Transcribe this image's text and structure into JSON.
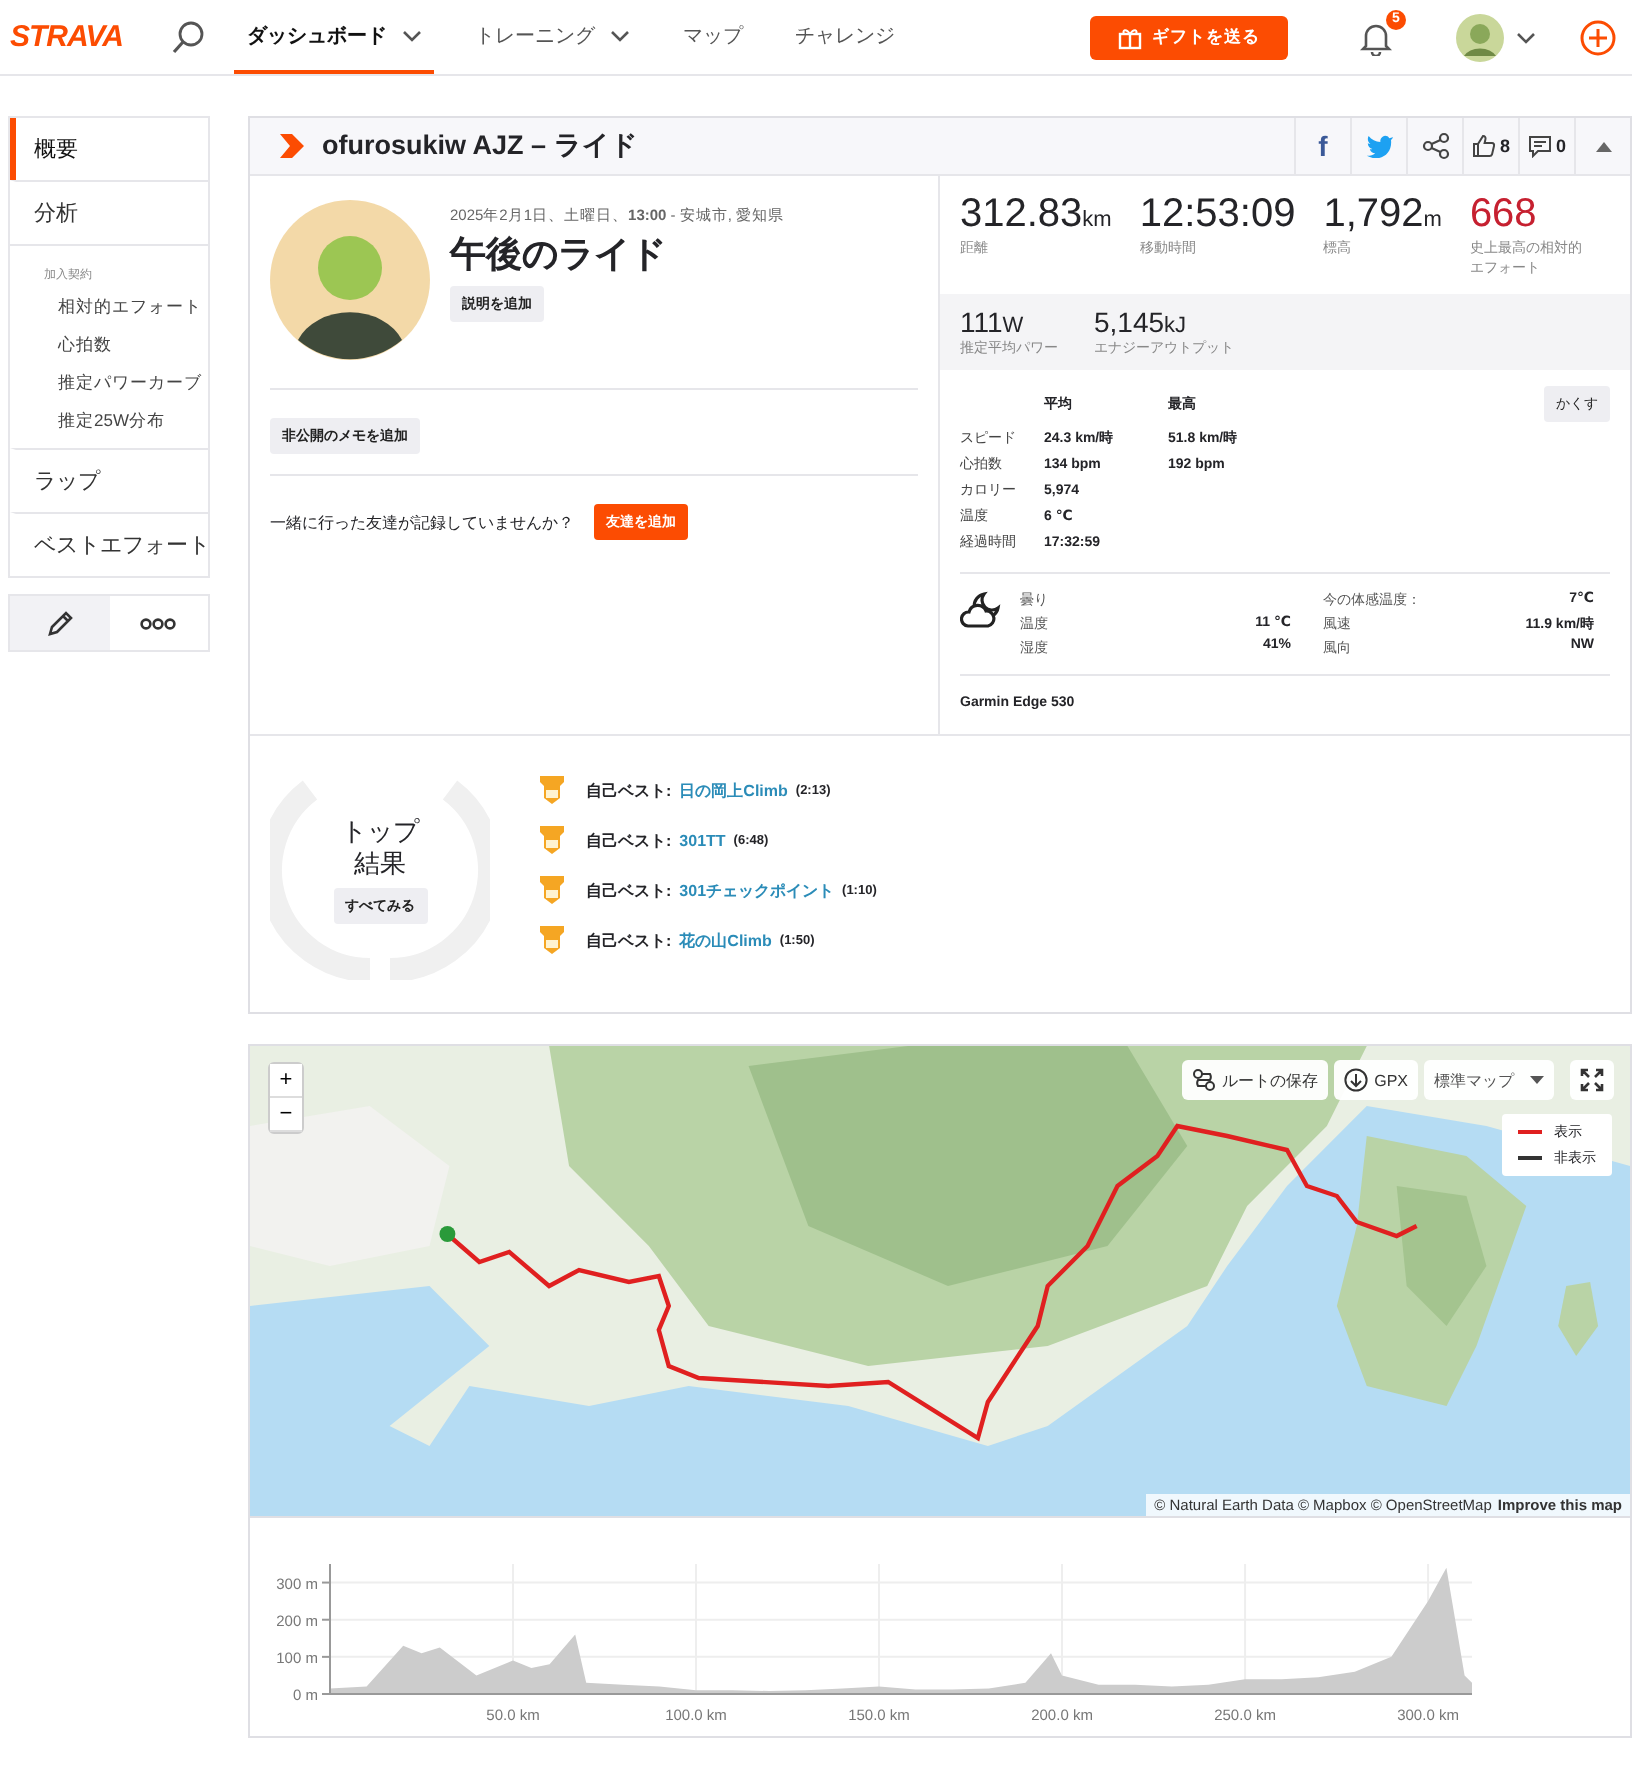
{
  "nav": {
    "logo": "STRAVA",
    "items": [
      {
        "label": "ダッシュボード",
        "selected": true,
        "dropdown": true
      },
      {
        "label": "トレーニング",
        "selected": false,
        "dropdown": true
      },
      {
        "label": "マップ",
        "selected": false,
        "dropdown": false
      },
      {
        "label": "チャレンジ",
        "selected": false,
        "dropdown": false
      }
    ],
    "gift_button": "ギフトを送る",
    "notification_count": "5"
  },
  "sidebar": {
    "items": [
      {
        "label": "概要",
        "kind": "main",
        "selected": true
      },
      {
        "label": "分析",
        "kind": "main",
        "selected": false
      },
      {
        "label": "加入契約",
        "kind": "heading",
        "selected": false
      },
      {
        "label": "相対的エフォート",
        "kind": "sub",
        "selected": false
      },
      {
        "label": "心拍数",
        "kind": "sub",
        "selected": false
      },
      {
        "label": "推定パワーカーブ",
        "kind": "sub",
        "selected": false
      },
      {
        "label": "推定25W分布",
        "kind": "sub",
        "selected": false
      },
      {
        "label": "ラップ",
        "kind": "main",
        "selected": false
      },
      {
        "label": "ベストエフォート",
        "kind": "main",
        "selected": false
      }
    ]
  },
  "activity": {
    "header": "ofurosukiw AJZ – ライド",
    "facebook_glyph": "f",
    "kudos": "8",
    "comments": "0",
    "date": "2025年2月1日、土曜日、**13:00** - 安城市, 愛知県",
    "title": "午後のライド",
    "description_button": "説明を追加",
    "note_button": "非公開のメモを追加",
    "friends_prompt": "一緒に行った友達が記録していませんか？",
    "friends_button": "友達を追加"
  },
  "stats": {
    "primary": [
      {
        "value": "312.83",
        "unit": "km",
        "label": "距離",
        "kind": "plain"
      },
      {
        "value": "12:53:09",
        "label": "移動時間",
        "kind": "plain"
      },
      {
        "value": "1,792",
        "unit": "m",
        "label": "標高",
        "kind": "plain"
      },
      {
        "value": "668",
        "label": "史上最高の相対的エフォート",
        "kind": "effort"
      }
    ],
    "secondary": [
      {
        "value": "111",
        "unit": "W",
        "label": "推定平均パワー"
      },
      {
        "value": "5,145",
        "unit": "kJ",
        "label": "エナジーアウトプット"
      }
    ],
    "columns": [
      "平均",
      "最高"
    ],
    "hide_button": "かくす",
    "rows": [
      {
        "label": "スピード",
        "avg": "24.3 km/時",
        "max": "51.8 km/時"
      },
      {
        "label": "心拍数",
        "avg": "134 bpm",
        "max": "192 bpm"
      },
      {
        "label": "カロリー",
        "avg": "5,974"
      },
      {
        "label": "温度",
        "avg": "6 ℃"
      },
      {
        "label": "経過時間",
        "avg": "17:32:59"
      }
    ],
    "weather": {
      "condition": "曇り",
      "left": [
        {
          "label": "温度",
          "value": "11 ℃"
        },
        {
          "label": "湿度",
          "value": "41%"
        }
      ],
      "right": [
        {
          "label": "今の体感温度：",
          "value": "7℃"
        },
        {
          "label": "風速",
          "value": "11.9 km/時"
        },
        {
          "label": "風向",
          "value": "NW"
        }
      ]
    },
    "device": "Garmin Edge 530"
  },
  "top_results": {
    "title_lines": [
      "トップ",
      "結果"
    ],
    "button": "すべてみる",
    "achievements": [
      {
        "prefix": "自己ベスト:",
        "segment": "日の岡上Climb",
        "time": "(2:13)"
      },
      {
        "prefix": "自己ベスト:",
        "segment": "301TT",
        "time": "(6:48)"
      },
      {
        "prefix": "自己ベスト:",
        "segment": "301チェックポイント",
        "time": "(1:10)"
      },
      {
        "prefix": "自己ベスト:",
        "segment": "花の山Climb",
        "time": "(1:50)"
      }
    ]
  },
  "map": {
    "kind": "picture",
    "zoom_in": "+",
    "zoom_out": "−",
    "save_route": "ルートの保存",
    "gpx": "GPX",
    "map_style": "標準マップ",
    "legend": [
      {
        "label": "表示",
        "color": "#e02020"
      },
      {
        "label": "非表示",
        "color": "#333333"
      }
    ],
    "attribution": "© Natural Earth Data © Mapbox © OpenStreetMap",
    "improve_link": "Improve this map"
  },
  "elevation": {
    "chart_data": {
      "type": "area",
      "x": [
        0,
        10,
        20,
        25,
        30,
        40,
        50,
        55,
        60,
        67,
        70,
        80,
        90,
        100,
        110,
        120,
        130,
        140,
        150,
        160,
        170,
        180,
        190,
        197,
        200,
        210,
        220,
        230,
        240,
        250,
        260,
        270,
        280,
        290,
        300,
        305,
        310,
        312
      ],
      "grid": true,
      "series": [
        {
          "color": "#cccccc",
          "values": [
            15,
            20,
            130,
            110,
            125,
            50,
            90,
            70,
            80,
            160,
            30,
            25,
            20,
            10,
            10,
            8,
            10,
            15,
            20,
            12,
            12,
            15,
            30,
            110,
            50,
            25,
            25,
            20,
            25,
            40,
            40,
            45,
            60,
            100,
            250,
            340,
            50,
            30
          ]
        }
      ],
      "xlim": [
        0,
        312
      ],
      "ylim": [
        0,
        350
      ],
      "xticks": [
        {
          "value": 50,
          "label": "50.0 km"
        },
        {
          "value": 100,
          "label": "100.0 km"
        },
        {
          "value": 150,
          "label": "150.0 km"
        },
        {
          "value": 200,
          "label": "200.0 km"
        },
        {
          "value": 250,
          "label": "250.0 km"
        },
        {
          "value": 300,
          "label": "300.0 km"
        }
      ],
      "yticks": [
        {
          "value": 0,
          "label": "0 m"
        },
        {
          "value": 100,
          "label": "100 m"
        },
        {
          "value": 200,
          "label": "200 m"
        },
        {
          "value": 300,
          "label": "300 m"
        }
      ]
    }
  }
}
